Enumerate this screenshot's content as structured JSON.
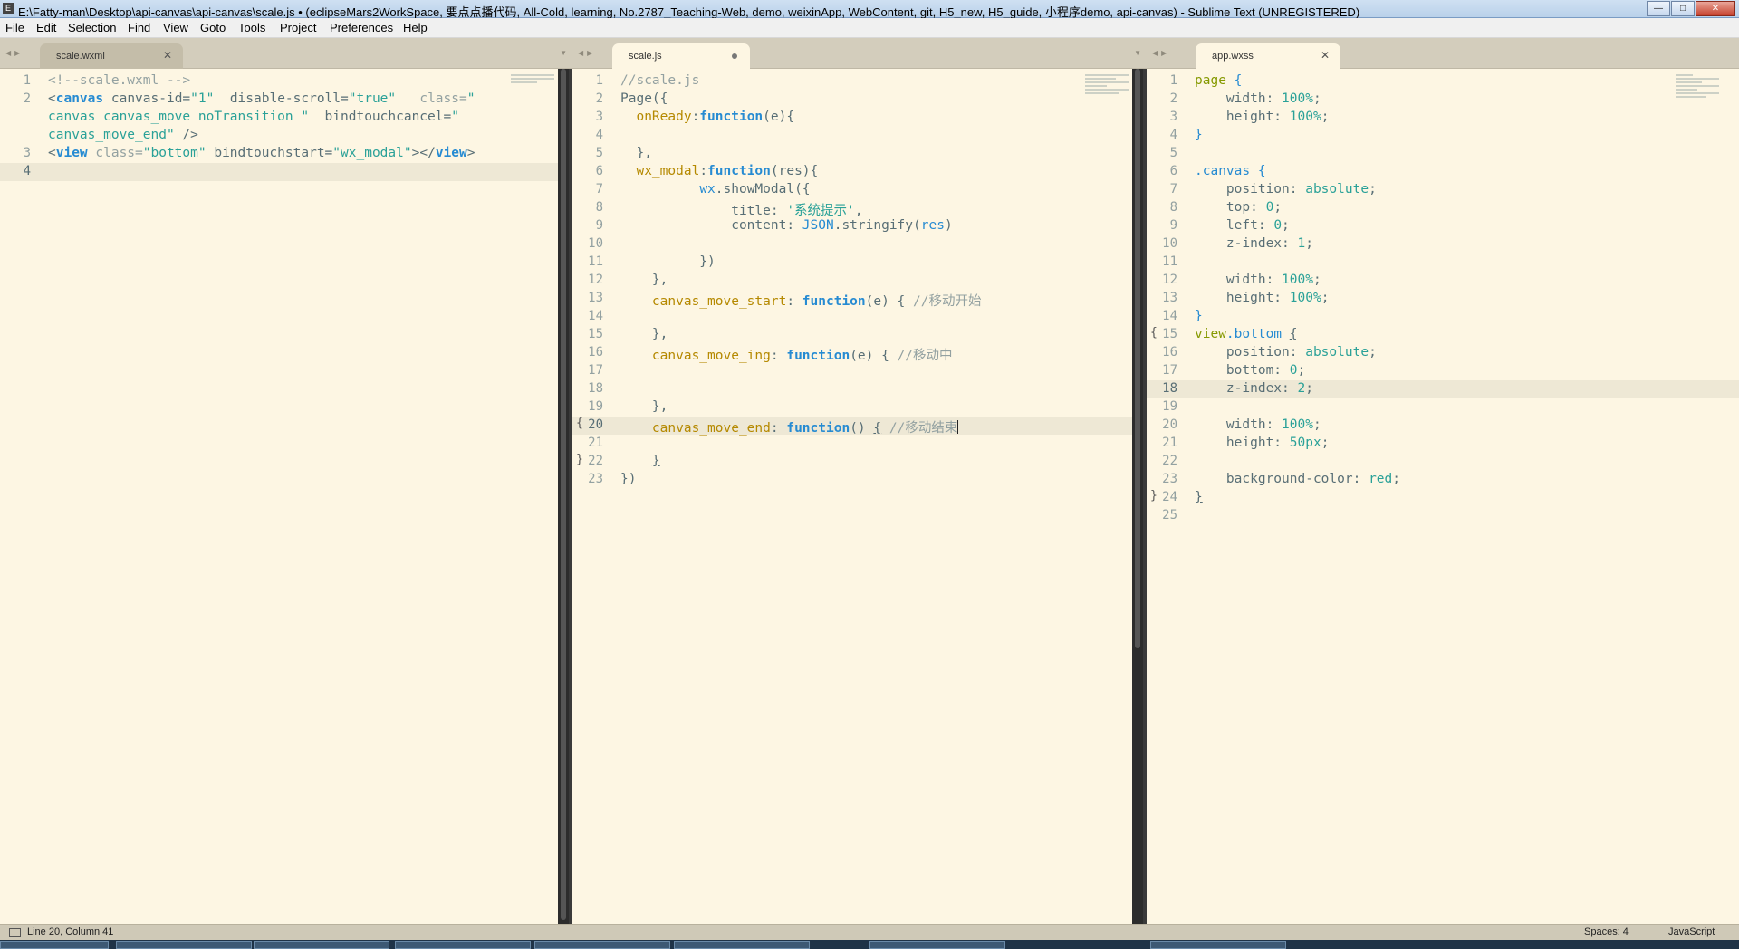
{
  "window": {
    "app_icon": "E",
    "title": "E:\\Fatty-man\\Desktop\\api-canvas\\api-canvas\\scale.js • (eclipseMars2WorkSpace, 要点点播代码, All-Cold, learning, No.2787_Teaching-Web, demo, weixinApp, WebContent, git, H5_new, H5_guide, 小程序demo, api-canvas) - Sublime Text (UNREGISTERED)",
    "minimize_icon": "minimize-icon",
    "maximize_icon": "maximize-icon",
    "close_icon": "close-icon"
  },
  "menu": [
    "File",
    "Edit",
    "Selection",
    "Find",
    "View",
    "Goto",
    "Tools",
    "Project",
    "Preferences",
    "Help"
  ],
  "tabs": [
    {
      "label": "scale.wxml",
      "state": "close"
    },
    {
      "label": "scale.js",
      "state": "dirty"
    },
    {
      "label": "app.wxss",
      "state": "close"
    }
  ],
  "panes": {
    "wxml": [
      {
        "n": "1",
        "t": [
          [
            "c",
            "<!--scale.wxml -->"
          ]
        ]
      },
      {
        "n": "2",
        "t": [
          [
            "o",
            "<"
          ],
          [
            "k",
            "canvas"
          ],
          [
            "o",
            " canvas-id="
          ],
          [
            "s",
            "\"1\""
          ],
          [
            "o",
            "  disable-scroll="
          ],
          [
            "s",
            "\"true\""
          ],
          [
            "c",
            "   class="
          ],
          [
            "s",
            "\""
          ]
        ]
      },
      {
        "n": "",
        "t": [
          [
            "s",
            "canvas canvas_move noTransition \""
          ],
          [
            "o",
            "  bindtouchcancel="
          ],
          [
            "s",
            "\""
          ]
        ]
      },
      {
        "n": "",
        "t": [
          [
            "s",
            "canvas_move_end\""
          ],
          [
            "o",
            " />"
          ]
        ]
      },
      {
        "n": "3",
        "t": [
          [
            "o",
            "<"
          ],
          [
            "k",
            "view"
          ],
          [
            "c",
            " class="
          ],
          [
            "s",
            "\"bottom\""
          ],
          [
            "o",
            " bindtouchstart="
          ],
          [
            "s",
            "\"wx_modal\""
          ],
          [
            "o",
            "></"
          ],
          [
            "k",
            "view"
          ],
          [
            "o",
            ">"
          ]
        ]
      },
      {
        "n": "4",
        "t": [
          [
            "o",
            ""
          ]
        ],
        "current": true
      }
    ],
    "js": [
      {
        "n": "1",
        "t": [
          [
            "c",
            "//scale.js"
          ]
        ]
      },
      {
        "n": "2",
        "t": [
          [
            "o",
            "Page({"
          ]
        ]
      },
      {
        "n": "3",
        "t": [
          [
            "y",
            "  onReady"
          ],
          [
            "o",
            ":"
          ],
          [
            "k",
            "function"
          ],
          [
            "o",
            "(e){"
          ]
        ]
      },
      {
        "n": "4",
        "t": [
          [
            "o",
            ""
          ]
        ]
      },
      {
        "n": "5",
        "t": [
          [
            "o",
            "  },"
          ]
        ]
      },
      {
        "n": "6",
        "t": [
          [
            "y",
            "  wx_modal"
          ],
          [
            "o",
            ":"
          ],
          [
            "k",
            "function"
          ],
          [
            "o",
            "(res){"
          ]
        ]
      },
      {
        "n": "7",
        "t": [
          [
            "o",
            "          "
          ],
          [
            "f",
            "wx"
          ],
          [
            "o",
            ".showModal({"
          ]
        ]
      },
      {
        "n": "8",
        "t": [
          [
            "o",
            "              title: "
          ],
          [
            "s",
            "'系统提示'"
          ],
          [
            "o",
            ","
          ]
        ]
      },
      {
        "n": "9",
        "t": [
          [
            "o",
            "              content: "
          ],
          [
            "f",
            "JSON"
          ],
          [
            "o",
            ".stringify("
          ],
          [
            "f",
            "res"
          ],
          [
            "o",
            ")"
          ]
        ]
      },
      {
        "n": "10",
        "t": [
          [
            "o",
            ""
          ]
        ]
      },
      {
        "n": "11",
        "t": [
          [
            "o",
            "          })"
          ]
        ]
      },
      {
        "n": "12",
        "t": [
          [
            "o",
            "    },"
          ]
        ]
      },
      {
        "n": "13",
        "t": [
          [
            "y",
            "    canvas_move_start"
          ],
          [
            "o",
            ": "
          ],
          [
            "k",
            "function"
          ],
          [
            "o",
            "(e) { "
          ],
          [
            "c",
            "//移动开始"
          ]
        ]
      },
      {
        "n": "14",
        "t": [
          [
            "o",
            ""
          ]
        ]
      },
      {
        "n": "15",
        "t": [
          [
            "o",
            "    },"
          ]
        ]
      },
      {
        "n": "16",
        "t": [
          [
            "y",
            "    canvas_move_ing"
          ],
          [
            "o",
            ": "
          ],
          [
            "k",
            "function"
          ],
          [
            "o",
            "(e) { "
          ],
          [
            "c",
            "//移动中"
          ]
        ]
      },
      {
        "n": "17",
        "t": [
          [
            "o",
            ""
          ]
        ]
      },
      {
        "n": "18",
        "t": [
          [
            "o",
            ""
          ]
        ]
      },
      {
        "n": "19",
        "t": [
          [
            "o",
            "    },"
          ]
        ]
      },
      {
        "n": "20",
        "t": [
          [
            "y",
            "    canvas_move_end"
          ],
          [
            "o",
            ": "
          ],
          [
            "k",
            "function"
          ],
          [
            "o",
            "() "
          ],
          [
            "u",
            "{"
          ],
          [
            "o",
            " "
          ],
          [
            "c",
            "//移动结束"
          ]
        ],
        "current": true,
        "fold": "{"
      },
      {
        "n": "21",
        "t": [
          [
            "o",
            ""
          ]
        ]
      },
      {
        "n": "22",
        "t": [
          [
            "o",
            "    "
          ],
          [
            "u",
            "}"
          ]
        ],
        "fold": "}"
      },
      {
        "n": "23",
        "t": [
          [
            "o",
            "})"
          ]
        ]
      }
    ],
    "wxss": [
      {
        "n": "1",
        "t": [
          [
            "g",
            "page"
          ],
          [
            "o",
            " "
          ],
          [
            "p",
            "{"
          ]
        ]
      },
      {
        "n": "2",
        "t": [
          [
            "o",
            "    width: "
          ],
          [
            "n",
            "100%"
          ],
          [
            "o",
            ";"
          ]
        ]
      },
      {
        "n": "3",
        "t": [
          [
            "o",
            "    height: "
          ],
          [
            "n",
            "100%"
          ],
          [
            "o",
            ";"
          ]
        ]
      },
      {
        "n": "4",
        "t": [
          [
            "p",
            "}"
          ]
        ]
      },
      {
        "n": "5",
        "t": [
          [
            "o",
            ""
          ]
        ]
      },
      {
        "n": "6",
        "t": [
          [
            "p",
            ".canvas"
          ],
          [
            "o",
            " "
          ],
          [
            "p",
            "{"
          ]
        ]
      },
      {
        "n": "7",
        "t": [
          [
            "o",
            "    position: "
          ],
          [
            "n",
            "absolute"
          ],
          [
            "o",
            ";"
          ]
        ]
      },
      {
        "n": "8",
        "t": [
          [
            "o",
            "    top: "
          ],
          [
            "n",
            "0"
          ],
          [
            "o",
            ";"
          ]
        ]
      },
      {
        "n": "9",
        "t": [
          [
            "o",
            "    left: "
          ],
          [
            "n",
            "0"
          ],
          [
            "o",
            ";"
          ]
        ]
      },
      {
        "n": "10",
        "t": [
          [
            "o",
            "    z-index: "
          ],
          [
            "n",
            "1"
          ],
          [
            "o",
            ";"
          ]
        ]
      },
      {
        "n": "11",
        "t": [
          [
            "o",
            ""
          ]
        ]
      },
      {
        "n": "12",
        "t": [
          [
            "o",
            "    width: "
          ],
          [
            "n",
            "100%"
          ],
          [
            "o",
            ";"
          ]
        ]
      },
      {
        "n": "13",
        "t": [
          [
            "o",
            "    height: "
          ],
          [
            "n",
            "100%"
          ],
          [
            "o",
            ";"
          ]
        ]
      },
      {
        "n": "14",
        "t": [
          [
            "p",
            "}"
          ]
        ]
      },
      {
        "n": "15",
        "t": [
          [
            "g",
            "view"
          ],
          [
            "p",
            ".bottom"
          ],
          [
            "o",
            " "
          ],
          [
            "u",
            "{"
          ]
        ],
        "fold": "{"
      },
      {
        "n": "16",
        "t": [
          [
            "o",
            "    position: "
          ],
          [
            "n",
            "absolute"
          ],
          [
            "o",
            ";"
          ]
        ]
      },
      {
        "n": "17",
        "t": [
          [
            "o",
            "    bottom: "
          ],
          [
            "n",
            "0"
          ],
          [
            "o",
            ";"
          ]
        ]
      },
      {
        "n": "18",
        "t": [
          [
            "o",
            "    z-index: "
          ],
          [
            "n",
            "2"
          ],
          [
            "o",
            ";"
          ]
        ],
        "current": true
      },
      {
        "n": "19",
        "t": [
          [
            "o",
            ""
          ]
        ]
      },
      {
        "n": "20",
        "t": [
          [
            "o",
            "    width: "
          ],
          [
            "n",
            "100%"
          ],
          [
            "o",
            ";"
          ]
        ]
      },
      {
        "n": "21",
        "t": [
          [
            "o",
            "    height: "
          ],
          [
            "n",
            "50px"
          ],
          [
            "o",
            ";"
          ]
        ]
      },
      {
        "n": "22",
        "t": [
          [
            "o",
            ""
          ]
        ]
      },
      {
        "n": "23",
        "t": [
          [
            "o",
            "    background-color: "
          ],
          [
            "n",
            "red"
          ],
          [
            "o",
            ";"
          ]
        ]
      },
      {
        "n": "24",
        "t": [
          [
            "u",
            "}"
          ]
        ],
        "fold": "}"
      },
      {
        "n": "25",
        "t": [
          [
            "o",
            ""
          ]
        ]
      }
    ]
  },
  "status": {
    "position": "Line 20, Column 41",
    "spaces": "Spaces: 4",
    "syntax": "JavaScript"
  },
  "colors": {
    "editor_bg": "#fdf6e3",
    "comment": "#93a1a1",
    "keyword": "#268bd2",
    "string": "#2aa198",
    "property": "#b58900"
  }
}
